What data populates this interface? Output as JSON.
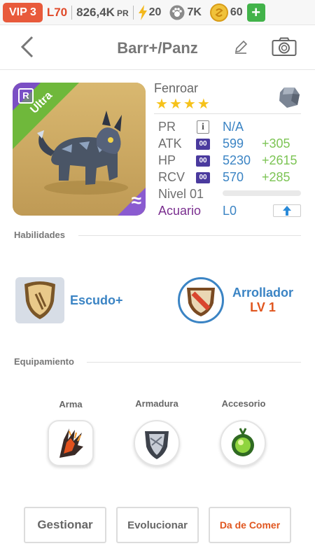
{
  "status_bar": {
    "vip": "VIP 3",
    "level": "L70",
    "power": "826,4K",
    "power_unit": "PR",
    "energy": "20",
    "paws": "7K",
    "coins": "60",
    "plus_icon": "plus-icon"
  },
  "header": {
    "title": "Barr+/Panz",
    "back_icon": "chevron-left-icon",
    "edit_icon": "pencil-icon",
    "camera_icon": "camera-icon"
  },
  "pet": {
    "name": "Fenroar",
    "rarity_tag": "R",
    "tier": "Ultra",
    "element_symbol": "≈",
    "stars": 4,
    "stats": [
      {
        "label": "PR",
        "badge": "i",
        "value": "N/A",
        "bonus": ""
      },
      {
        "label": "ATK",
        "badge": "00",
        "value": "599",
        "bonus": "+305"
      },
      {
        "label": "HP",
        "badge": "00",
        "value": "5230",
        "bonus": "+2615"
      },
      {
        "label": "RCV",
        "badge": "00",
        "value": "570",
        "bonus": "+285"
      }
    ],
    "level_label": "Nivel 01",
    "level_progress": 0,
    "aquarium_label": "Acuario",
    "aquarium_value": "L0",
    "colors": {
      "accent": "#3b84c4",
      "bonus": "#7cc454",
      "aquarium": "#7a2f8f"
    }
  },
  "abilities": {
    "title": "Habilidades",
    "items": [
      {
        "name": "Escudo+",
        "level": ""
      },
      {
        "name": "Arrollador",
        "level": "LV 1"
      }
    ]
  },
  "equipment": {
    "title": "Equipamiento",
    "slots": [
      {
        "label": "Arma"
      },
      {
        "label": "Armadura"
      },
      {
        "label": "Accesorio"
      }
    ]
  },
  "actions": {
    "manage": "Gestionar",
    "evolve": "Evolucionar",
    "feed": "Da de Comer"
  }
}
